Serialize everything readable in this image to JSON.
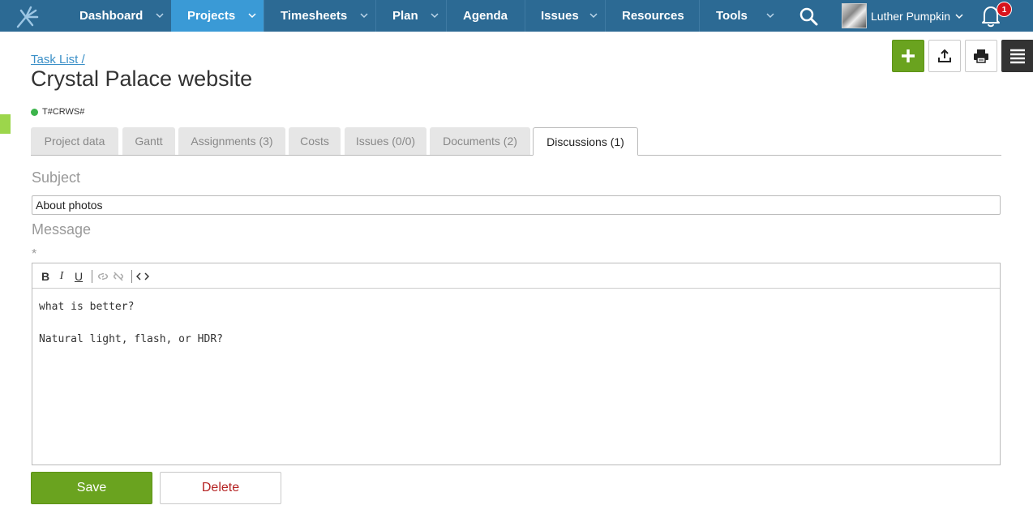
{
  "nav": {
    "items": [
      {
        "label": "Dashboard",
        "icon": "chevron-down-icon"
      },
      {
        "label": "Projects",
        "icon": "chevron-down-icon"
      },
      {
        "label": "Timesheets",
        "icon": "chevron-down-icon"
      },
      {
        "label": "Plan",
        "icon": "chevron-down-icon"
      },
      {
        "label": "Agenda"
      },
      {
        "label": "Issues",
        "icon": "chevron-down-icon"
      },
      {
        "label": "Resources"
      },
      {
        "label": "Tools",
        "icon": "chevron-down-icon"
      }
    ],
    "active_index": 1,
    "user_name": "Luther Pumpkin",
    "notification_count": "1",
    "colors": {
      "bar": "#2c6a94",
      "active": "#3a9ad6",
      "badge": "#d9141c"
    }
  },
  "header": {
    "breadcrumb": "Task List /",
    "title": "Crystal Palace website",
    "code": "T#CRWS#",
    "status_color": "#3cb44b"
  },
  "toolbar": {
    "icons": [
      "plus-icon",
      "export-icon",
      "print-icon",
      "menu-icon"
    ],
    "accent": "#6aa31f"
  },
  "tabs": [
    {
      "label": "Project data"
    },
    {
      "label": "Gantt"
    },
    {
      "label": "Assignments (3)"
    },
    {
      "label": "Costs"
    },
    {
      "label": "Issues (0/0)"
    },
    {
      "label": "Documents (2)"
    },
    {
      "label": "Discussions (1)",
      "active": true
    }
  ],
  "form": {
    "subject_label": "Subject",
    "subject_value": "About photos",
    "message_label": "Message",
    "required_mark": "*",
    "editor_tools": [
      "bold-icon",
      "italic-icon",
      "underline-icon",
      "link-icon",
      "unlink-icon",
      "code-icon"
    ],
    "message_lines": [
      "what is better?",
      "Natural light, flash, or HDR?"
    ]
  },
  "actions": {
    "save_label": "Save",
    "delete_label": "Delete"
  }
}
